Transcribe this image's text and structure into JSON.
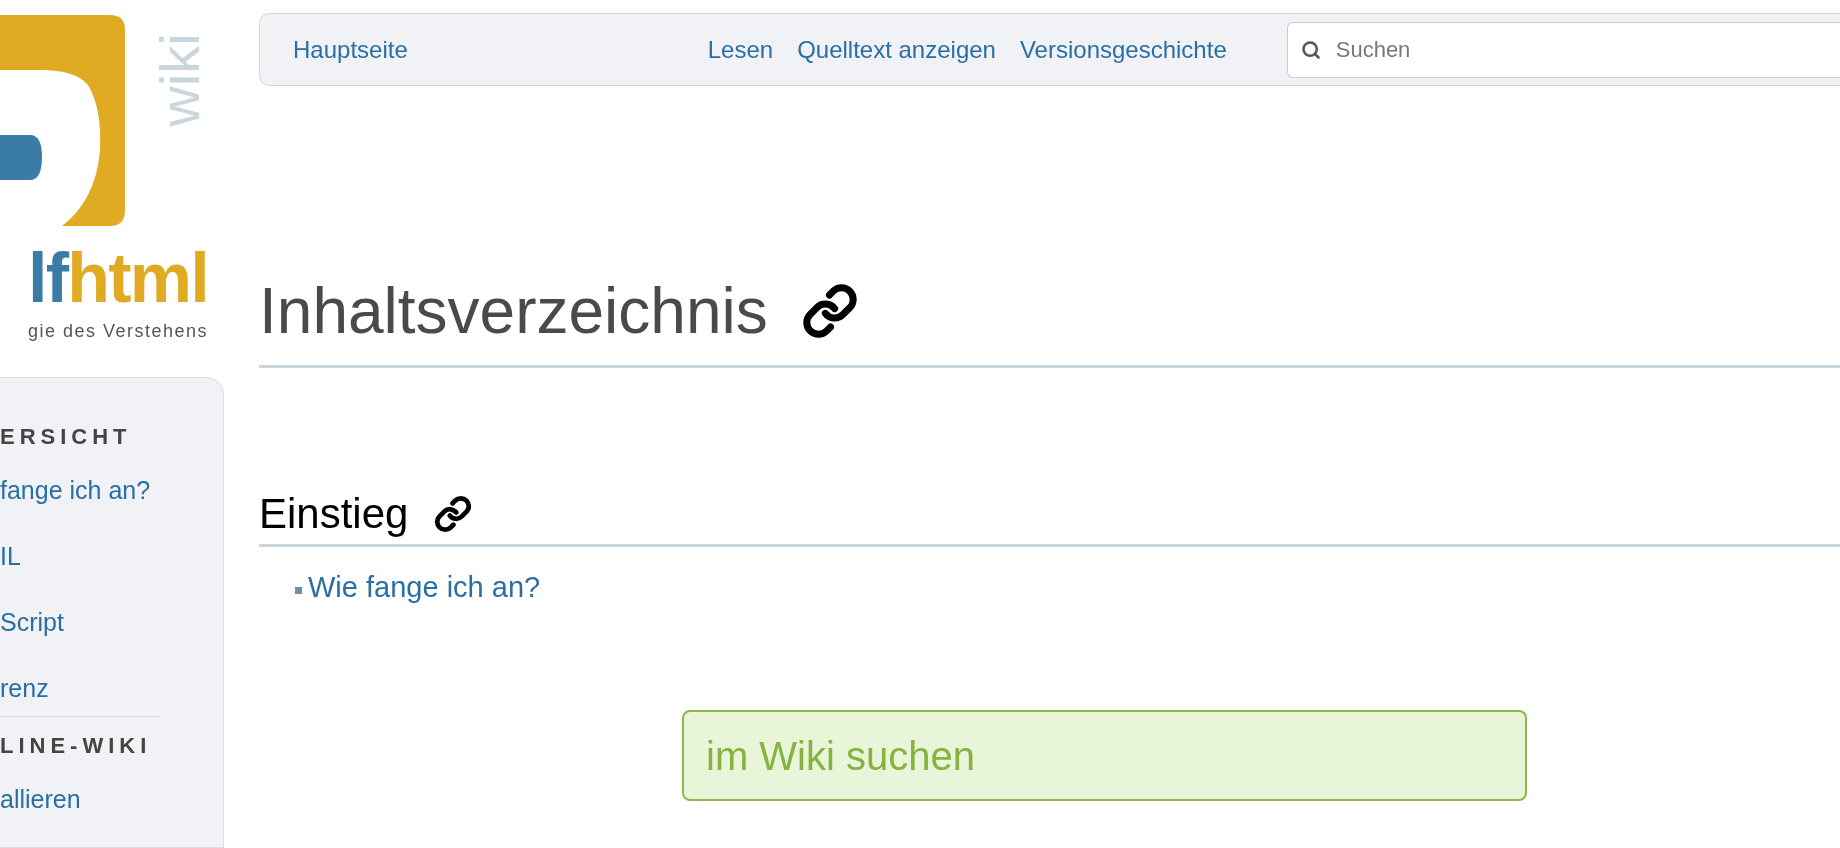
{
  "logo": {
    "side_text": "wiki",
    "wordmark_left": "lf",
    "wordmark_right": "html",
    "tagline": "gie des Verstehens"
  },
  "sidebar": {
    "sections": [
      {
        "heading": "ERSICHT",
        "items": [
          "fange ich an?",
          "IL",
          "Script",
          "renz"
        ]
      },
      {
        "heading": "LINE-WIKI",
        "items": [
          "allieren"
        ]
      }
    ]
  },
  "nav": {
    "left": [
      "Hauptseite"
    ],
    "actions": [
      "Lesen",
      "Quelltext anzeigen",
      "Versionsgeschichte"
    ],
    "search_placeholder": "Suchen"
  },
  "page": {
    "title": "Inhaltsverzeichnis",
    "sections": [
      {
        "heading": "Einstieg",
        "links": [
          "Wie fange ich an?"
        ]
      }
    ],
    "search_button": "im Wiki suchen"
  }
}
